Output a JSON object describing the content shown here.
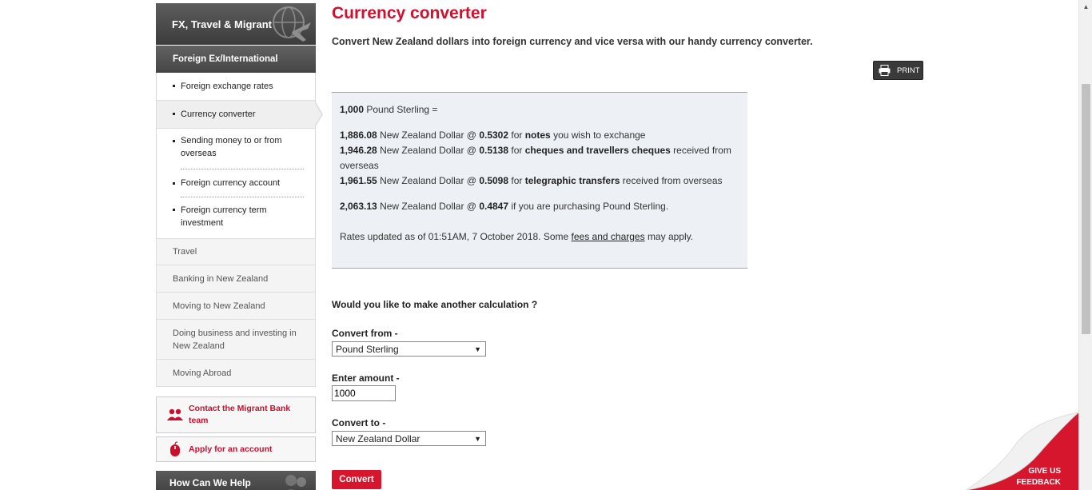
{
  "sidebar": {
    "header": "FX, Travel & Migrant",
    "section": "Foreign Ex/International",
    "sub_items": [
      {
        "label": "Foreign exchange rates"
      },
      {
        "label": "Currency converter"
      },
      {
        "label": "Sending money to or from overseas"
      },
      {
        "label": "Foreign currency account"
      },
      {
        "label": "Foreign currency term investment"
      }
    ],
    "main_items": [
      {
        "label": "Travel"
      },
      {
        "label": "Banking in New Zealand"
      },
      {
        "label": "Moving to New Zealand"
      },
      {
        "label": "Doing business and investing in New Zealand"
      },
      {
        "label": "Moving Abroad"
      }
    ],
    "cta_contact": "Contact the Migrant Bank team",
    "cta_apply": "Apply for an account",
    "help": "How Can We Help"
  },
  "main": {
    "title": "Currency converter",
    "intro": "Convert New Zealand dollars into foreign currency and vice versa with our handy currency converter.",
    "print_label": "PRINT",
    "result": {
      "base_amount": "1,000",
      "base_currency_text": "Pound Sterling =",
      "rows": [
        {
          "amount": "1,886.08",
          "text": "New Zealand Dollar @",
          "rate": "0.5302",
          "pre": "for",
          "kind": "notes",
          "post": "you wish to exchange"
        },
        {
          "amount": "1,946.28",
          "text": "New Zealand Dollar @",
          "rate": "0.5138",
          "pre": "for",
          "kind": "cheques and travellers cheques",
          "post": "received from overseas"
        },
        {
          "amount": "1,961.55",
          "text": "New Zealand Dollar @",
          "rate": "0.5098",
          "pre": "for",
          "kind": "telegraphic transfers",
          "post": "received from overseas"
        }
      ],
      "purchase": {
        "amount": "2,063.13",
        "text": "New Zealand Dollar @",
        "rate": "0.4847",
        "post": "if you are purchasing Pound Sterling."
      },
      "updated_prefix": "Rates updated as of 01:51AM, 7 October 2018. Some",
      "fees_link": "fees and charges",
      "updated_suffix": "may apply."
    },
    "calc_question": "Would you like to make another calculation ?",
    "convert_from_label": "Convert from -",
    "convert_from_value": "Pound Sterling",
    "amount_label": "Enter amount -",
    "amount_value": "1000",
    "convert_to_label": "Convert to -",
    "convert_to_value": "New Zealand Dollar",
    "convert_button": "Convert"
  },
  "feedback": {
    "line1": "GIVE US",
    "line2": "FEEDBACK"
  },
  "colors": {
    "brand_red": "#d0102e",
    "sidebar_dark": "#4a4a4a",
    "result_bg": "#edf1f5"
  }
}
